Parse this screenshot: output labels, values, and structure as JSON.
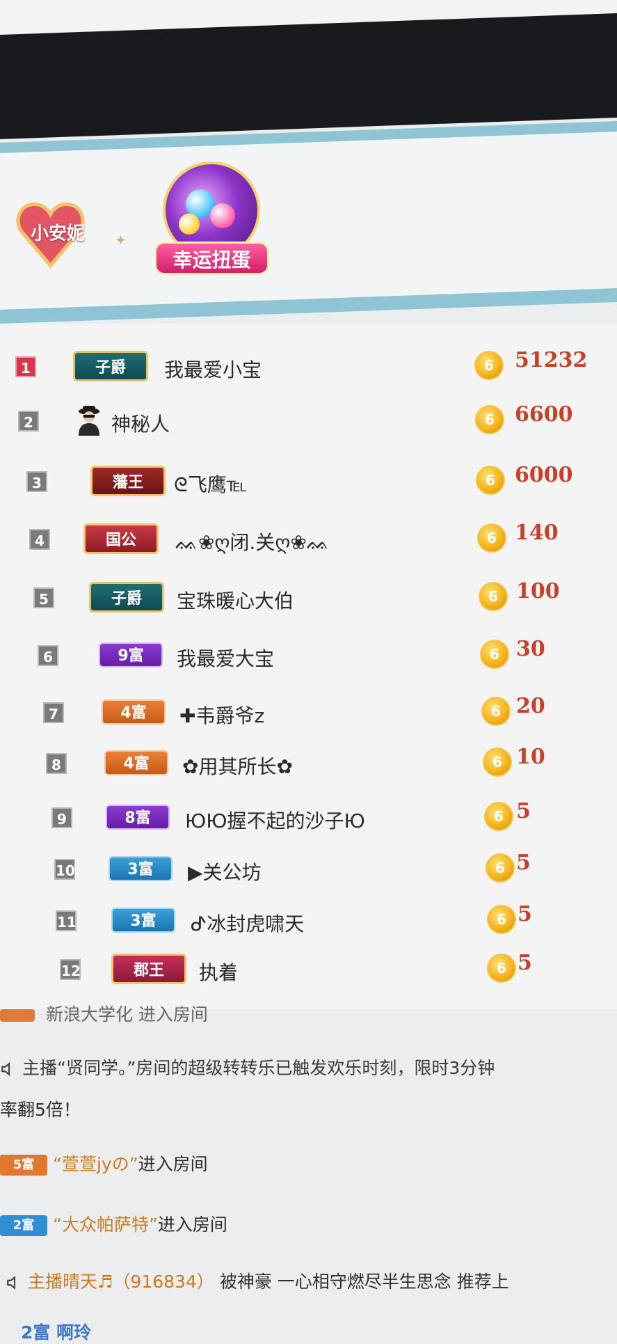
{
  "header": {
    "heart_badge_text": "小安妮",
    "gacha_label": "幸运扭蛋",
    "sparkle_glyph": "✦"
  },
  "ranking": [
    {
      "rank": "1",
      "badge": "子爵",
      "badge_style": "zijue",
      "name": "我最爱小宝",
      "amount": "51232"
    },
    {
      "rank": "2",
      "badge": "",
      "badge_style": "none",
      "icon": "mystery-person-icon",
      "name": "神秘人",
      "amount": "6600"
    },
    {
      "rank": "3",
      "badge": "藩王",
      "badge_style": "fanwang",
      "name": "ᘓ飞鹰℡",
      "amount": "6000"
    },
    {
      "rank": "4",
      "badge": "国公",
      "badge_style": "guogong",
      "name": "ᨐ❀ღ闭.关ღ❀ᨐ",
      "amount": "140"
    },
    {
      "rank": "5",
      "badge": "子爵",
      "badge_style": "zijue",
      "name": "宝珠暖心大伯",
      "amount": "100"
    },
    {
      "rank": "6",
      "badge": "9富",
      "badge_style": "purple",
      "name": "我最爱大宝",
      "amount": "30"
    },
    {
      "rank": "7",
      "badge": "4富",
      "badge_style": "orange",
      "name": "✚韦爵爷z",
      "amount": "20"
    },
    {
      "rank": "8",
      "badge": "4富",
      "badge_style": "orange",
      "name": "✿用其所长✿",
      "amount": "10"
    },
    {
      "rank": "9",
      "badge": "8富",
      "badge_style": "purple",
      "name": "ЮЮ握不起的沙子Ю",
      "amount": "5"
    },
    {
      "rank": "10",
      "badge": "3富",
      "badge_style": "blue",
      "name": "▶关公坊",
      "amount": "5"
    },
    {
      "rank": "11",
      "badge": "3富",
      "badge_style": "blue",
      "name": "ᕷ冰封虎啸天",
      "amount": "5"
    },
    {
      "rank": "12",
      "badge": "郡王",
      "badge_style": "junwang",
      "name": "执着",
      "amount": "5"
    }
  ],
  "coin_glyph": "6",
  "chat": {
    "line_partial": "新浪大学化 进入房间",
    "system1_a": "主播“贤同学。”房间的超级转转乐已触发欢乐时刻，限时3分钟",
    "system1_b": "率翻5倍！",
    "enter1_badge": "5富",
    "enter1_user": "“萱萱jyの”",
    "enter1_text": "进入房间",
    "enter2_badge": "2富",
    "enter2_user": "“大众帕萨特”",
    "enter2_text": "进入房间",
    "system2_host": "主播晴天♬（916834）",
    "system2_text": "被神豪 一心相守燃尽半生思念 推荐上",
    "last_partial": "2富  啊玲"
  }
}
